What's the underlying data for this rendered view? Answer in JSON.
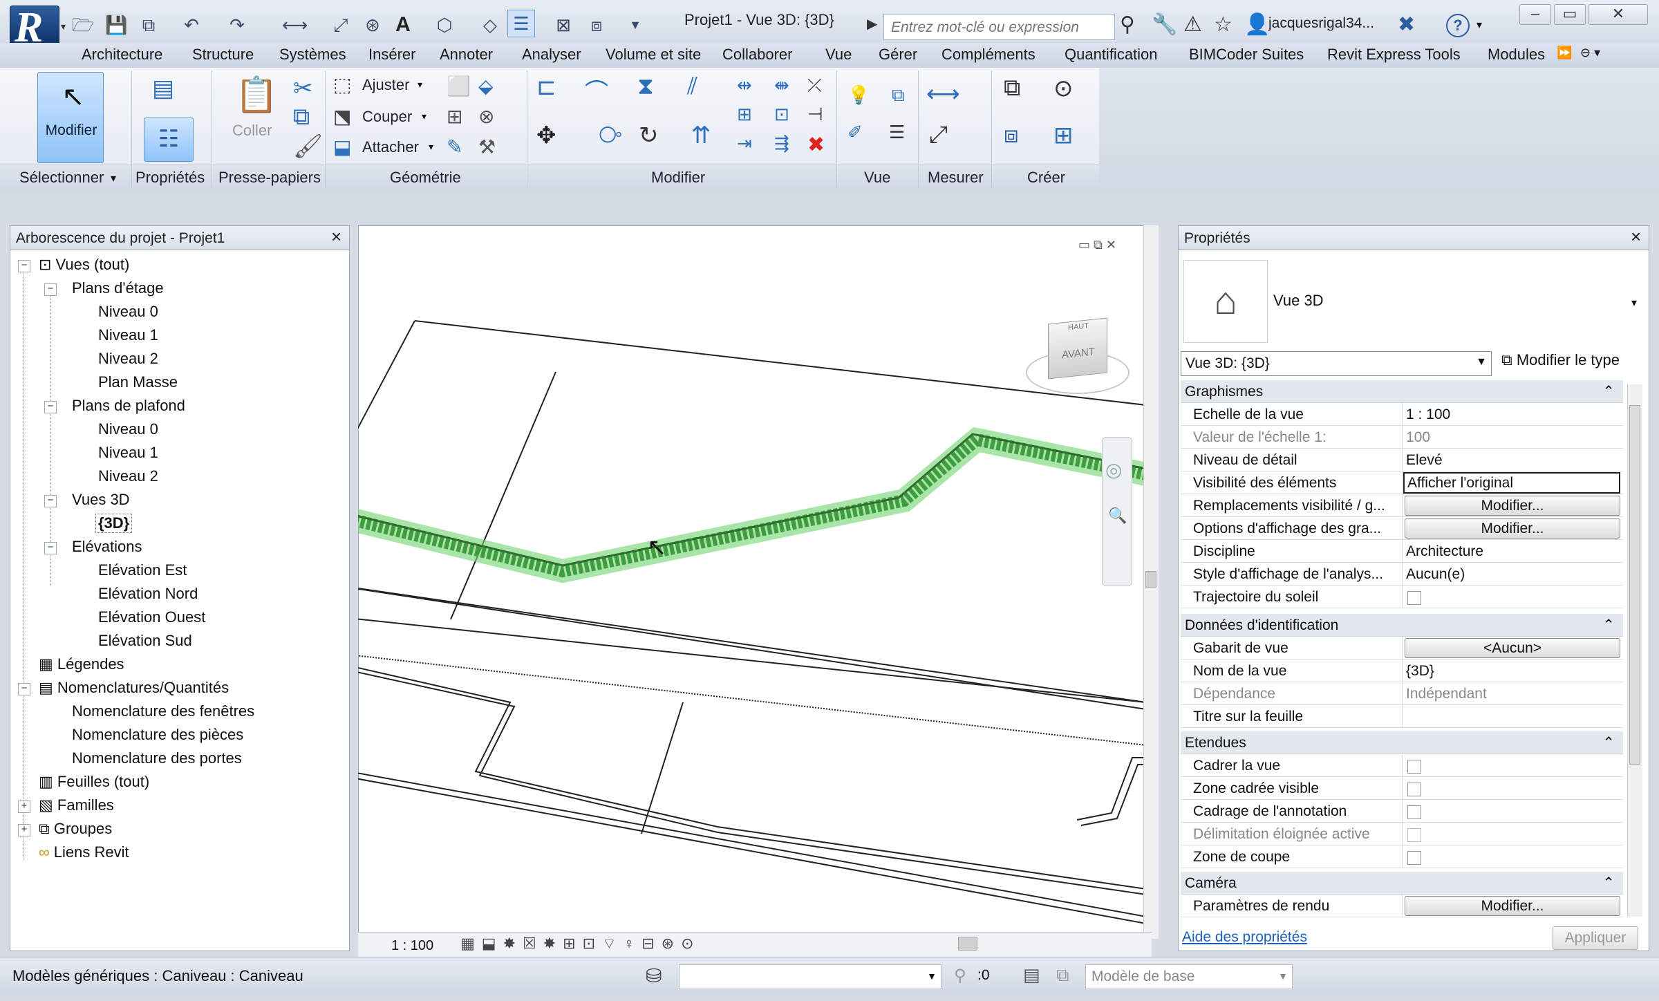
{
  "app": {
    "title": "Projet1 - Vue 3D: {3D}",
    "logo_letter": "R",
    "search_placeholder": "Entrez mot-clé ou expression",
    "user": "jacquesrigal34...",
    "accent": "#8fc3f7",
    "highlight_green": "#6fd36f"
  },
  "menu": [
    "Architecture",
    "Structure",
    "Systèmes",
    "Insérer",
    "Annoter",
    "Analyser",
    "Volume et site",
    "Collaborer",
    "Vue",
    "Gérer",
    "Compléments",
    "Quantification",
    "BIMCoder Suites",
    "Revit Express Tools",
    "Modules"
  ],
  "ribbon": {
    "modify": "Modifier",
    "paste": "Coller",
    "trim": "Ajuster",
    "cut": "Couper",
    "join": "Attacher",
    "panels": [
      "Sélectionner",
      "Propriétés",
      "Presse-papiers",
      "Géométrie",
      "Modifier",
      "Vue",
      "Mesurer",
      "Créer"
    ]
  },
  "browser": {
    "title": "Arborescence du projet - Projet1",
    "items": [
      {
        "label": "Vues (tout)"
      },
      {
        "label": "Plans d'étage"
      },
      {
        "label": "Niveau 0"
      },
      {
        "label": "Niveau 1"
      },
      {
        "label": "Niveau 2"
      },
      {
        "label": "Plan Masse"
      },
      {
        "label": "Plans de plafond"
      },
      {
        "label": "Niveau 0"
      },
      {
        "label": "Niveau 1"
      },
      {
        "label": "Niveau 2"
      },
      {
        "label": "Vues 3D"
      },
      {
        "label": "{3D}"
      },
      {
        "label": "Elévations"
      },
      {
        "label": "Elévation Est"
      },
      {
        "label": "Elévation Nord"
      },
      {
        "label": "Elévation Ouest"
      },
      {
        "label": "Elévation Sud"
      },
      {
        "label": "Légendes"
      },
      {
        "label": "Nomenclatures/Quantités"
      },
      {
        "label": "Nomenclature des fenêtres"
      },
      {
        "label": "Nomenclature des pièces"
      },
      {
        "label": "Nomenclature des portes"
      },
      {
        "label": "Feuilles (tout)"
      },
      {
        "label": "Familles"
      },
      {
        "label": "Groupes"
      },
      {
        "label": "Liens Revit"
      }
    ]
  },
  "viewport": {
    "viewcube_top": "HAUT",
    "viewcube_front": "AVANT",
    "scale": "1 : 100"
  },
  "properties": {
    "title": "Propriétés",
    "type_name": "Vue 3D",
    "selector": "Vue 3D: {3D}",
    "edit_type": "Modifier le type",
    "groups": {
      "graphics": "Graphismes",
      "identity": "Données d'identification",
      "extents": "Etendues",
      "camera": "Caméra"
    },
    "rows": {
      "scale_name": "Echelle de la vue",
      "scale_val": "1 : 100",
      "scale_value_name": "Valeur de l'échelle   1:",
      "scale_value_val": "100",
      "detail_name": "Niveau de détail",
      "detail_val": "Elevé",
      "visibility_name": "Visibilité des éléments",
      "visibility_val": "Afficher l'original",
      "overrides_name": "Remplacements visibilité / g...",
      "overrides_val": "Modifier...",
      "display_name": "Options d'affichage des gra...",
      "display_val": "Modifier...",
      "discipline_name": "Discipline",
      "discipline_val": "Architecture",
      "analysis_name": "Style d'affichage de l'analys...",
      "analysis_val": "Aucun(e)",
      "sunpath_name": "Trajectoire du soleil",
      "template_name": "Gabarit de vue",
      "template_val": "<Aucun>",
      "viewname_name": "Nom de la vue",
      "viewname_val": "{3D}",
      "dependency_name": "Dépendance",
      "dependency_val": "Indépendant",
      "sheet_title_name": "Titre sur la feuille",
      "crop_name": "Cadrer la vue",
      "crop_visible_name": "Zone cadrée visible",
      "annotation_crop_name": "Cadrage de l'annotation",
      "far_clip_name": "Délimitation éloignée active",
      "section_box_name": "Zone de coupe",
      "render_name": "Paramètres de rendu",
      "render_val": "Modifier..."
    },
    "help_link": "Aide des propriétés",
    "apply": "Appliquer"
  },
  "status": {
    "message": "Modèles génériques : Caniveau : Caniveau",
    "count": ":0",
    "model": "Modèle de base"
  }
}
